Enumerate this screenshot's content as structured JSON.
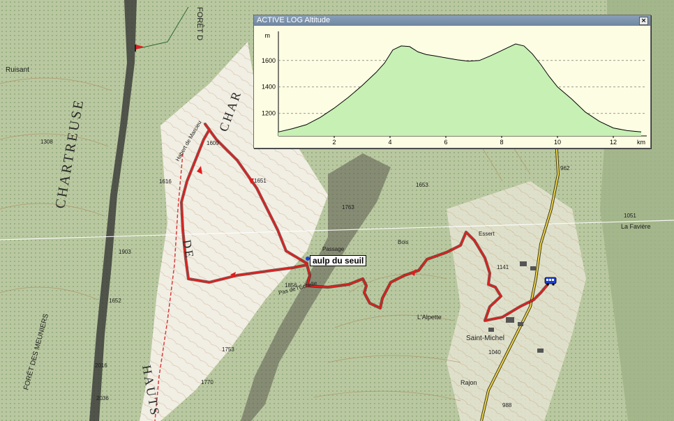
{
  "window": {
    "title": "ACTIVE LOG Altitude",
    "close_glyph": "×"
  },
  "waypoint": {
    "label": "aulp du seuil"
  },
  "map_labels": [
    {
      "text": "FORÊT D",
      "big": false
    },
    {
      "text": "Ruisant",
      "big": false
    },
    {
      "text": "CHARTREUSE",
      "big": true
    },
    {
      "text": "HAUTS",
      "big": true
    },
    {
      "text": "DE",
      "big": true
    },
    {
      "text": "CHAR",
      "big": true
    },
    {
      "text": "Habert de Marcieu",
      "big": false
    },
    {
      "text": "Pas de l'Échelle",
      "big": false
    },
    {
      "text": "Saint-Michel",
      "big": false
    },
    {
      "text": "L'Alpette",
      "big": false
    },
    {
      "text": "La Favière",
      "big": false
    },
    {
      "text": "FORÊT DES MEUNIERS",
      "big": false
    },
    {
      "text": "Rajon",
      "big": false
    },
    {
      "text": "Essert",
      "big": false
    },
    {
      "text": "Bois",
      "big": false
    },
    {
      "text": "Passage",
      "big": false
    },
    {
      "text": "1609",
      "big": false
    },
    {
      "text": "1651",
      "big": false
    },
    {
      "text": "1763",
      "big": false
    },
    {
      "text": "1856",
      "big": false
    },
    {
      "text": "1753",
      "big": false
    },
    {
      "text": "1770",
      "big": false
    },
    {
      "text": "1903",
      "big": false
    },
    {
      "text": "1308",
      "big": false
    },
    {
      "text": "1141",
      "big": false
    },
    {
      "text": "1051",
      "big": false
    },
    {
      "text": "1040",
      "big": false
    },
    {
      "text": "962",
      "big": false
    },
    {
      "text": "988",
      "big": false
    },
    {
      "text": "1653",
      "big": false
    },
    {
      "text": "1616",
      "big": false
    },
    {
      "text": "1652",
      "big": false
    },
    {
      "text": "2016",
      "big": false
    },
    {
      "text": "2036",
      "big": false
    }
  ],
  "chart_data": {
    "type": "area",
    "title": "",
    "xlabel": "km",
    "ylabel": "m",
    "xlim": [
      0,
      13.2
    ],
    "ylim": [
      1030,
      1820
    ],
    "x_ticks": [
      2,
      4,
      6,
      8,
      10,
      12
    ],
    "y_ticks": [
      1200,
      1400,
      1600
    ],
    "grid": "horizontal dashed",
    "fill_color": "#c7f0b4",
    "line_color": "#000000",
    "x": [
      0,
      0.5,
      1,
      1.5,
      2,
      2.5,
      3,
      3.5,
      3.8,
      4.1,
      4.4,
      4.7,
      5.0,
      5.3,
      5.6,
      6.0,
      6.4,
      6.8,
      7.2,
      7.6,
      7.9,
      8.2,
      8.5,
      8.8,
      9.1,
      9.4,
      9.7,
      10.0,
      10.5,
      11,
      11.5,
      12,
      12.5,
      13
    ],
    "y": [
      1060,
      1085,
      1115,
      1170,
      1240,
      1320,
      1410,
      1510,
      1580,
      1680,
      1710,
      1705,
      1665,
      1645,
      1635,
      1620,
      1605,
      1595,
      1600,
      1635,
      1665,
      1695,
      1725,
      1710,
      1650,
      1570,
      1480,
      1400,
      1310,
      1210,
      1140,
      1090,
      1070,
      1060
    ]
  }
}
